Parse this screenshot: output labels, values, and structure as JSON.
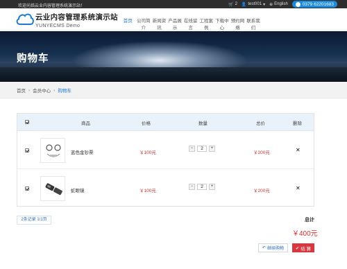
{
  "topbar": {
    "welcome": "欢迎光临云业内容管理系统演示站！",
    "cart_count": "2",
    "user": "test001",
    "language": "English",
    "phone": "0379 62201683"
  },
  "header": {
    "brand_cn": "云业内容管理系统演示站",
    "brand_en": "YUNYECMS Demo"
  },
  "nav": [
    {
      "label": "首页",
      "active": true
    },
    {
      "label": "公司简介"
    },
    {
      "label": "新闻资讯"
    },
    {
      "label": "产品展示"
    },
    {
      "label": "在线留言"
    },
    {
      "label": "工程案例"
    },
    {
      "label": "下载中心"
    },
    {
      "label": "预约网络"
    },
    {
      "label": "联系我们"
    }
  ],
  "banner": {
    "title": "购物车"
  },
  "breadcrumb": {
    "home": "首页",
    "member": "会员中心",
    "current": "购物车"
  },
  "cart": {
    "headers": {
      "product": "商品",
      "price": "价格",
      "qty": "数量",
      "total": "总价",
      "delete": "删除"
    },
    "rows": [
      {
        "name": "蓝色金钞票",
        "price": "￥100元",
        "qty": "2",
        "total": "￥200元"
      },
      {
        "name": "蛇眼镜",
        "price": "￥100元",
        "qty": "2",
        "total": "￥200元"
      }
    ]
  },
  "pager": {
    "text": "2条记录 1/1页"
  },
  "summary": {
    "label": "总计",
    "value": "￥400元"
  },
  "buttons": {
    "continue": "继续购物",
    "checkout": "结 算"
  },
  "colors": {
    "accent": "#1b7bd0",
    "price": "#d62c2c",
    "checkout": "#d9363e"
  }
}
